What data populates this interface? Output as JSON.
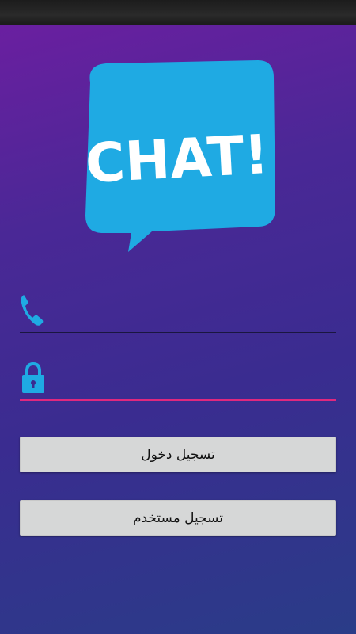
{
  "logo": {
    "text": "CHAT!",
    "color": "#1faae3",
    "text_color": "#ffffff"
  },
  "phone_field": {
    "icon": "phone-icon",
    "value": "",
    "placeholder": ""
  },
  "password_field": {
    "icon": "lock-icon",
    "value": "",
    "placeholder": "",
    "focus_color": "#e0287e"
  },
  "buttons": {
    "login_label": "تسجيل دخول",
    "register_label": "تسجيل مستخدم"
  },
  "colors": {
    "accent": "#1faae3",
    "background_top": "#6a1fa0",
    "background_bottom": "#2a3c88",
    "button_bg": "#d6d7d7"
  }
}
